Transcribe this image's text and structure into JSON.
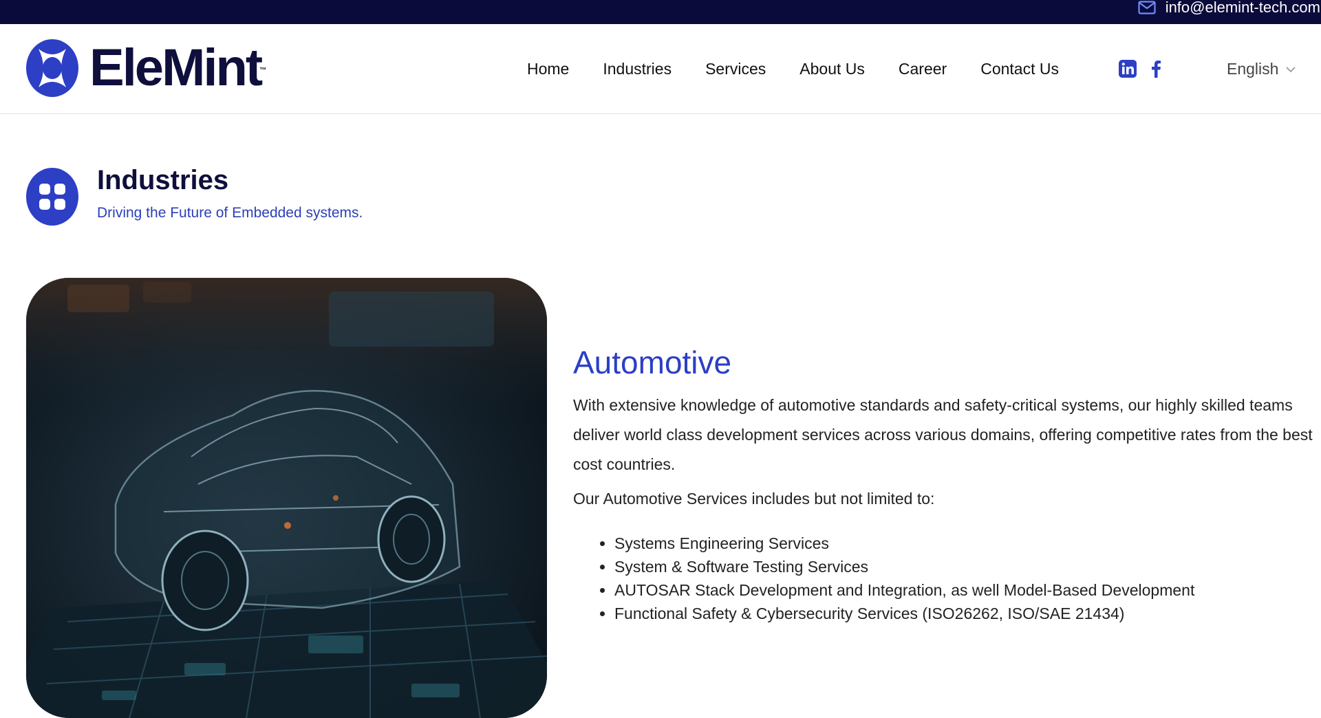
{
  "topbar": {
    "email": "info@elemint-tech.com"
  },
  "header": {
    "logo_text": "EleMint",
    "logo_tm": "™",
    "nav": [
      {
        "label": "Home"
      },
      {
        "label": "Industries"
      },
      {
        "label": "Services"
      },
      {
        "label": "About Us"
      },
      {
        "label": "Career"
      },
      {
        "label": "Contact Us"
      }
    ],
    "language": "English"
  },
  "section": {
    "title": "Industries",
    "subtitle": "Driving the Future of Embedded systems."
  },
  "content": {
    "title": "Automotive",
    "paragraph": "With extensive knowledge of automotive standards and safety-critical systems, our highly skilled teams deliver world class development services across various domains, offering competitive rates from the best cost countries.",
    "lead": "Our Automotive Services includes but not limited to:",
    "services": [
      "Systems Engineering Services",
      "System & Software Testing Services",
      "AUTOSAR Stack Development and Integration, as well Model-Based Development",
      "Functional Safety & Cybersecurity Services (ISO26262, ISO/SAE 21434)"
    ]
  },
  "colors": {
    "topbar": "#0b0b3b",
    "accent": "#2b3fc4",
    "brand_text": "#0f0f3d"
  },
  "icons": {
    "email": "mail-icon",
    "linkedin": "linkedin-icon",
    "facebook": "facebook-icon",
    "language_caret": "chevron-down-icon",
    "section": "grid-icon"
  }
}
